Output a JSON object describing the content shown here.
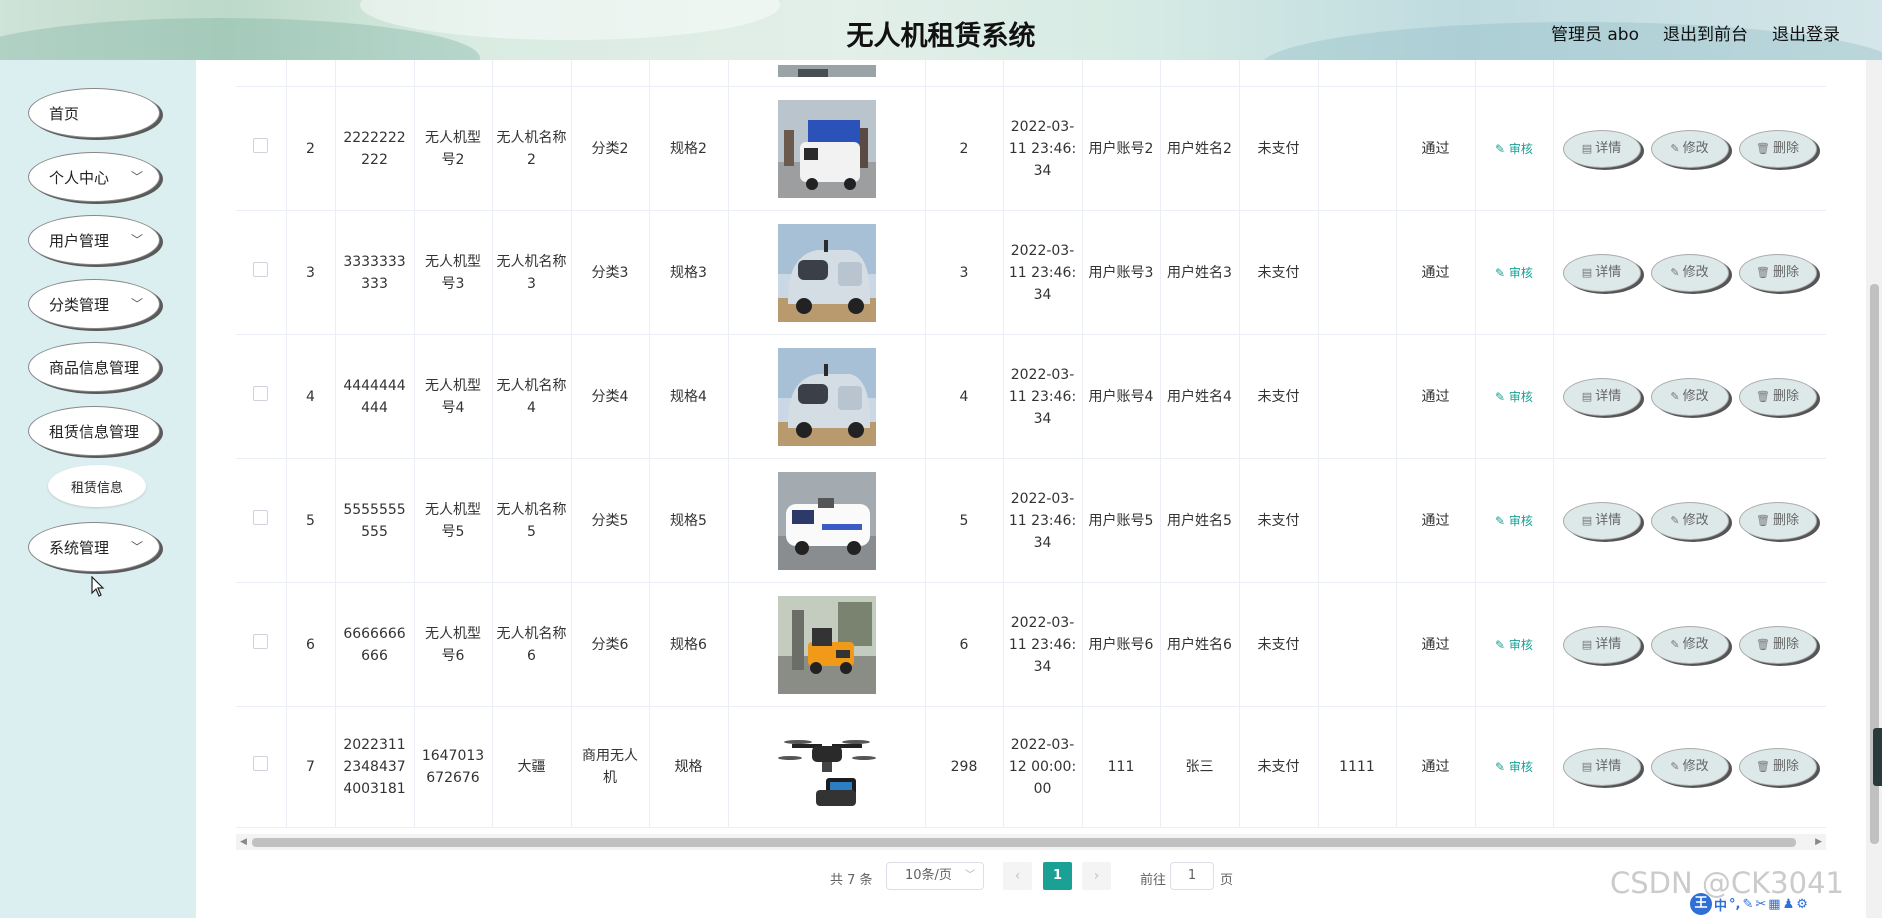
{
  "header": {
    "title": "无人机租赁系统",
    "links": [
      "管理员 abo",
      "退出到前台",
      "退出登录"
    ]
  },
  "sidebar": {
    "items": [
      {
        "label": "首页",
        "chevron": false
      },
      {
        "label": "个人中心",
        "chevron": true
      },
      {
        "label": "用户管理",
        "chevron": true
      },
      {
        "label": "分类管理",
        "chevron": true
      },
      {
        "label": "商品信息管理",
        "chevron": false
      },
      {
        "label": "租赁信息管理",
        "chevron": false
      }
    ],
    "sub_item": "租赁信息",
    "system_item": "系统管理"
  },
  "table": {
    "rows": [
      {
        "index": "2",
        "order_no": "2222222222",
        "model": "无人机型号2",
        "name": "无人机名称2",
        "category": "分类2",
        "spec": "规格2",
        "image": "blue-delivery-robot",
        "quantity": "2",
        "time": "2022-03-11 23:46:34",
        "account": "用户账号2",
        "username": "用户姓名2",
        "pay_status": "未支付",
        "remark": "",
        "status": "通过"
      },
      {
        "index": "3",
        "order_no": "3333333333",
        "model": "无人机型号3",
        "name": "无人机名称3",
        "category": "分类3",
        "spec": "规格3",
        "image": "grey-delivery-car",
        "quantity": "3",
        "time": "2022-03-11 23:46:34",
        "account": "用户账号3",
        "username": "用户姓名3",
        "pay_status": "未支付",
        "remark": "",
        "status": "通过"
      },
      {
        "index": "4",
        "order_no": "4444444444",
        "model": "无人机型号4",
        "name": "无人机名称4",
        "category": "分类4",
        "spec": "规格4",
        "image": "grey-delivery-car",
        "quantity": "4",
        "time": "2022-03-11 23:46:34",
        "account": "用户账号4",
        "username": "用户姓名4",
        "pay_status": "未支付",
        "remark": "",
        "status": "通过"
      },
      {
        "index": "5",
        "order_no": "5555555555",
        "model": "无人机型号5",
        "name": "无人机名称5",
        "category": "分类5",
        "spec": "规格5",
        "image": "white-delivery-van",
        "quantity": "5",
        "time": "2022-03-11 23:46:34",
        "account": "用户账号5",
        "username": "用户姓名5",
        "pay_status": "未支付",
        "remark": "",
        "status": "通过"
      },
      {
        "index": "6",
        "order_no": "6666666666",
        "model": "无人机型号6",
        "name": "无人机名称6",
        "category": "分类6",
        "spec": "规格6",
        "image": "orange-cart",
        "quantity": "6",
        "time": "2022-03-11 23:46:34",
        "account": "用户账号6",
        "username": "用户姓名6",
        "pay_status": "未支付",
        "remark": "",
        "status": "通过"
      },
      {
        "index": "7",
        "order_no": "20223112348437 4003181",
        "model": "1647013672676",
        "name": "大疆",
        "category": "商用无人机",
        "spec": "规格",
        "image": "quadcopter-drone",
        "quantity": "298",
        "time": "2022-03-12 00:00:00",
        "account": "111",
        "username": "张三",
        "pay_status": "未支付",
        "remark": "1111",
        "status": "通过"
      }
    ],
    "audit_label": "审核",
    "op_labels": {
      "detail": "详情",
      "edit": "修改",
      "delete": "删除"
    }
  },
  "pagination": {
    "total": "共 7 条",
    "page_size": "10条/页",
    "current_page": "1",
    "goto_label": "前往",
    "goto_value": "1",
    "page_suffix": "页"
  },
  "watermark": "CSDN @CK3041",
  "ime": {
    "logo": "王",
    "glyphs": [
      "中",
      "°,",
      "✎",
      "✂",
      "▦",
      "♟",
      "⚙"
    ]
  },
  "colors": {
    "accent": "#1aa094",
    "sidebar_bg": "#dbeef0",
    "button_bg": "#dde8e8"
  }
}
